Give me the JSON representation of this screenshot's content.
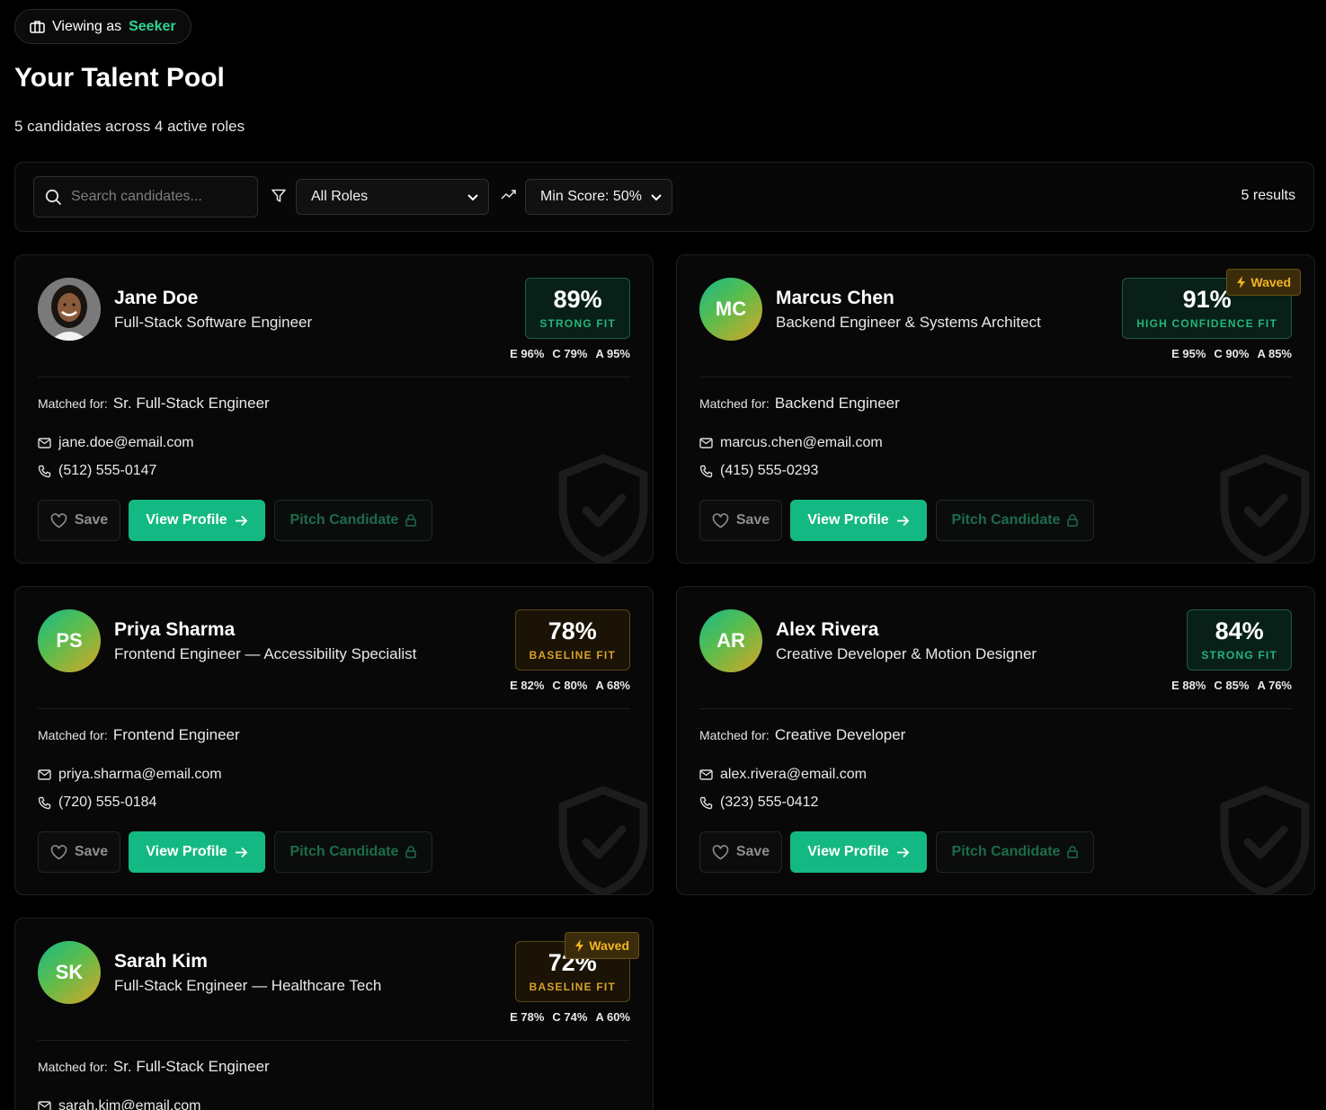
{
  "header": {
    "viewing_prefix": "Viewing as",
    "viewing_role": "Seeker",
    "title": "Your Talent Pool",
    "subtitle": "5 candidates across 4 active roles"
  },
  "toolbar": {
    "search_placeholder": "Search candidates...",
    "roles_value": "All Roles",
    "score_value": "Min Score: 50%",
    "results": "5 results"
  },
  "labels": {
    "matched_for": "Matched for:",
    "save": "Save",
    "view_profile": "View Profile",
    "pitch": "Pitch Candidate",
    "waved": "Waved"
  },
  "colors": {
    "accent": "#14b883",
    "strong": "#26b37d",
    "baseline": "#d8a128",
    "waved": "#f2b423"
  },
  "candidates": [
    {
      "initials": "",
      "name": "Jane Doe",
      "title": "Full-Stack Software Engineer",
      "score": "89%",
      "fit": "STRONG FIT",
      "e": "E 96%",
      "c": "C 79%",
      "a": "A 95%",
      "matched": "Sr. Full-Stack Engineer",
      "email": "jane.doe@email.com",
      "phone": "(512) 555-0147"
    },
    {
      "initials": "MC",
      "name": "Marcus Chen",
      "title": "Backend Engineer & Systems Architect",
      "score": "91%",
      "fit": "HIGH CONFIDENCE FIT",
      "e": "E 95%",
      "c": "C 90%",
      "a": "A 85%",
      "matched": "Backend Engineer",
      "email": "marcus.chen@email.com",
      "phone": "(415) 555-0293"
    },
    {
      "initials": "PS",
      "name": "Priya Sharma",
      "title": "Frontend Engineer — Accessibility Specialist",
      "score": "78%",
      "fit": "BASELINE FIT",
      "e": "E 82%",
      "c": "C 80%",
      "a": "A 68%",
      "matched": "Frontend Engineer",
      "email": "priya.sharma@email.com",
      "phone": "(720) 555-0184"
    },
    {
      "initials": "AR",
      "name": "Alex Rivera",
      "title": "Creative Developer & Motion Designer",
      "score": "84%",
      "fit": "STRONG FIT",
      "e": "E 88%",
      "c": "C 85%",
      "a": "A 76%",
      "matched": "Creative Developer",
      "email": "alex.rivera@email.com",
      "phone": "(323) 555-0412"
    },
    {
      "initials": "SK",
      "name": "Sarah Kim",
      "title": "Full-Stack Engineer — Healthcare Tech",
      "score": "72%",
      "fit": "BASELINE FIT",
      "e": "E 78%",
      "c": "C 74%",
      "a": "A 60%",
      "matched": "Sr. Full-Stack Engineer",
      "email": "sarah.kim@email.com",
      "phone": ""
    }
  ]
}
